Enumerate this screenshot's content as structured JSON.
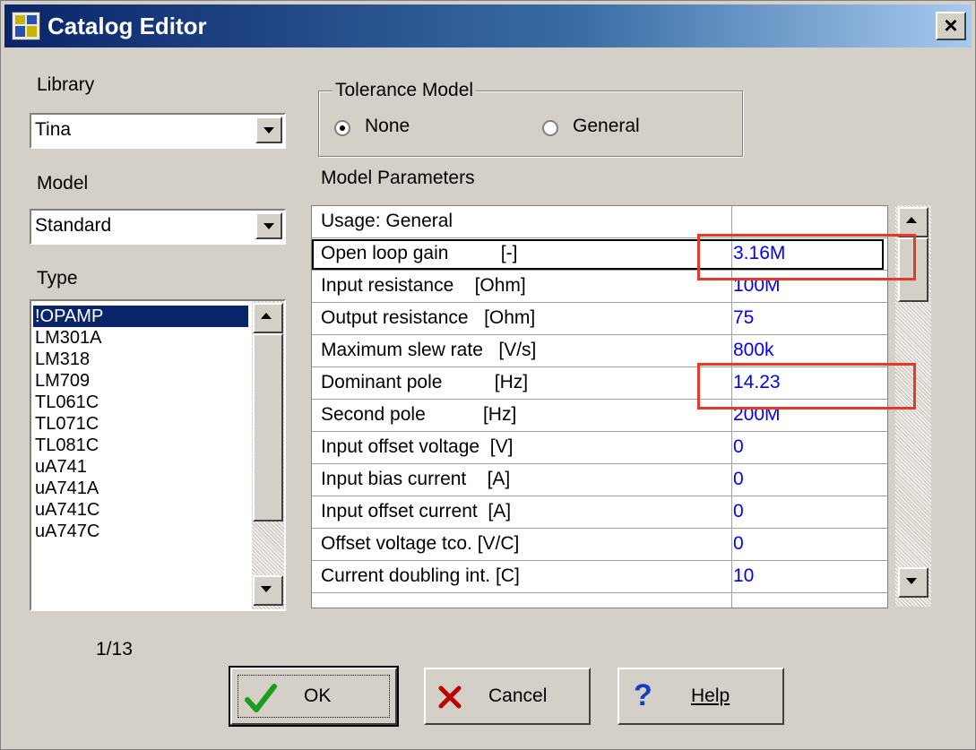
{
  "window": {
    "title": "Catalog Editor"
  },
  "library": {
    "label": "Library",
    "value": "Tina"
  },
  "model": {
    "label": "Model",
    "value": "Standard"
  },
  "type": {
    "label": "Type",
    "items": [
      "!OPAMP",
      "LM301A",
      "LM318",
      "LM709",
      "TL061C",
      "TL071C",
      "TL081C",
      "uA741",
      "uA741A",
      "uA741C",
      "uA747C"
    ],
    "selected_index": 0
  },
  "counter": "1/13",
  "tolerance": {
    "label": "Tolerance Model",
    "options": [
      "None",
      "General"
    ],
    "selected": "None"
  },
  "params": {
    "label": "Model Parameters",
    "usage": "Usage: General",
    "rows": [
      {
        "name": "Open loop gain          [-]",
        "value": "3.16M"
      },
      {
        "name": "Input resistance    [Ohm]",
        "value": "100M"
      },
      {
        "name": "Output resistance   [Ohm]",
        "value": "75"
      },
      {
        "name": "Maximum slew rate   [V/s]",
        "value": "800k"
      },
      {
        "name": "Dominant pole          [Hz]",
        "value": "14.23"
      },
      {
        "name": "Second pole           [Hz]",
        "value": "200M"
      },
      {
        "name": "Input offset voltage  [V]",
        "value": "0"
      },
      {
        "name": "Input bias current    [A]",
        "value": "0"
      },
      {
        "name": "Input offset current  [A]",
        "value": "0"
      },
      {
        "name": "Offset voltage tco. [V/C]",
        "value": "0"
      },
      {
        "name": "Current doubling int. [C]",
        "value": "10"
      }
    ],
    "highlight_color": "#e8382a"
  },
  "buttons": {
    "ok": "OK",
    "cancel": "Cancel",
    "help": "Help"
  },
  "colors": {
    "selection": "#0a246a",
    "value_text": "#0000ff",
    "face": "#d4d0c8"
  }
}
